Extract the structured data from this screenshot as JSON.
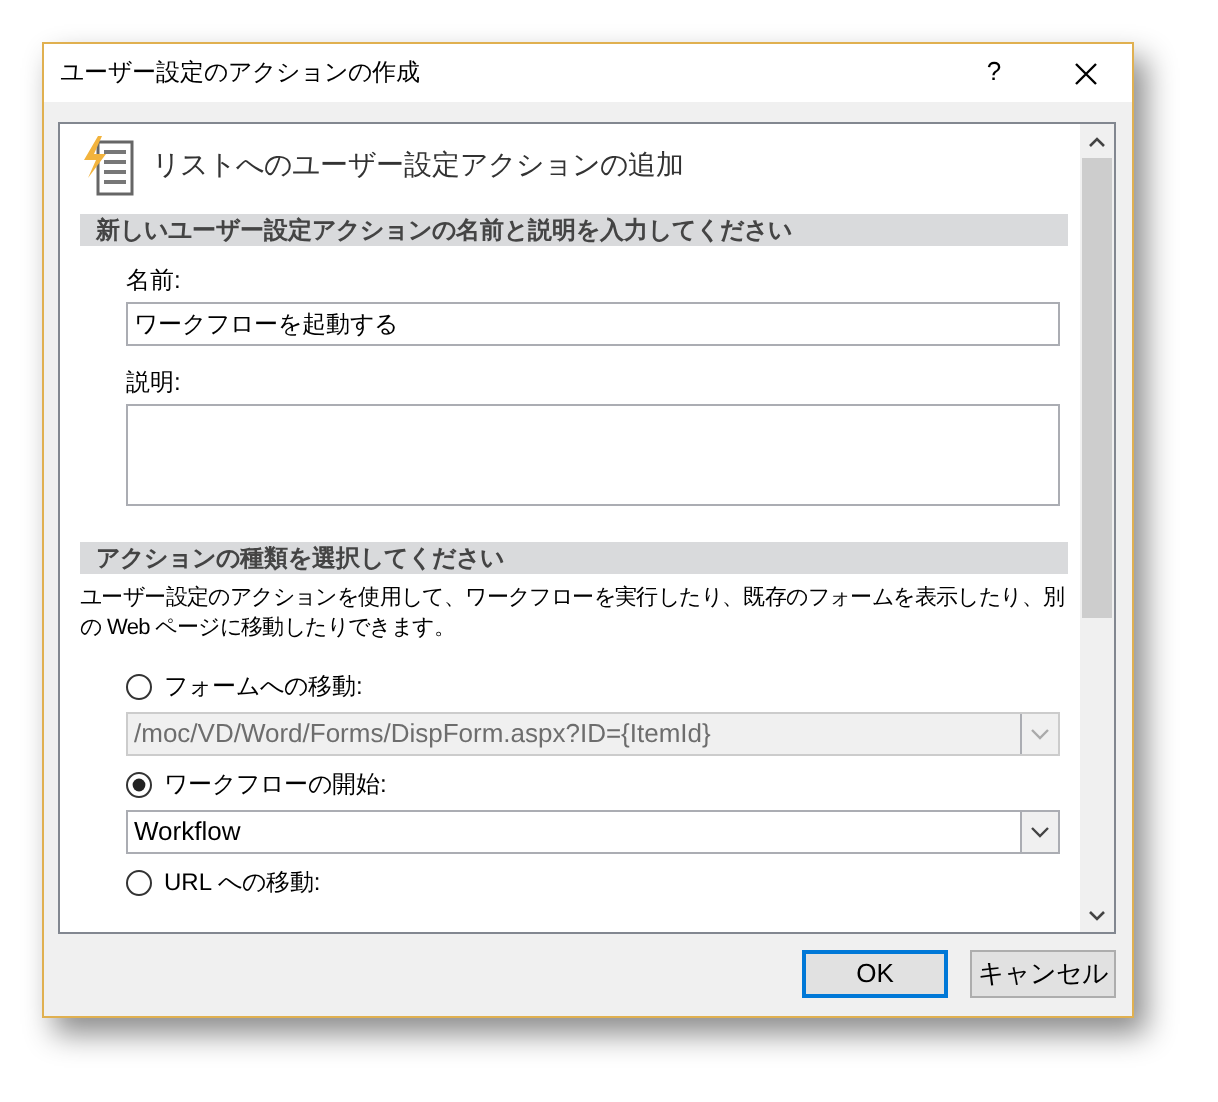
{
  "window": {
    "title": "ユーザー設定のアクションの作成",
    "help_button": "?"
  },
  "panel": {
    "heading": "リストへのユーザー設定アクションの追加",
    "sections": [
      {
        "kind": "name",
        "title": "新しいユーザー設定アクションの名前と説明を入力してください",
        "name_label": "名前:",
        "name_value": "ワークフローを起動する",
        "description_label": "説明:"
      },
      {
        "kind": "action",
        "title": "アクションの種類を選択してください",
        "text": "ユーザー設定のアクションを使用して、ワークフローを実行したり、既存のフォームを表示したり、別の Web ページに移動したりできます。",
        "options": [
          {
            "label": "フォームへの移動:",
            "selected": false,
            "dropdown": {
              "value": "/moc/VD/Word/Forms/DispForm.aspx?ID={ItemId}",
              "disabled": true
            }
          },
          {
            "label": "ワークフローの開始:",
            "selected": true,
            "dropdown": {
              "value": "Workflow",
              "disabled": false
            }
          },
          {
            "label": "URL への移動:",
            "selected": false
          }
        ]
      }
    ]
  },
  "buttons": [
    {
      "label": "OK",
      "default": true
    },
    {
      "label": "キャンセル",
      "default": false
    }
  ]
}
